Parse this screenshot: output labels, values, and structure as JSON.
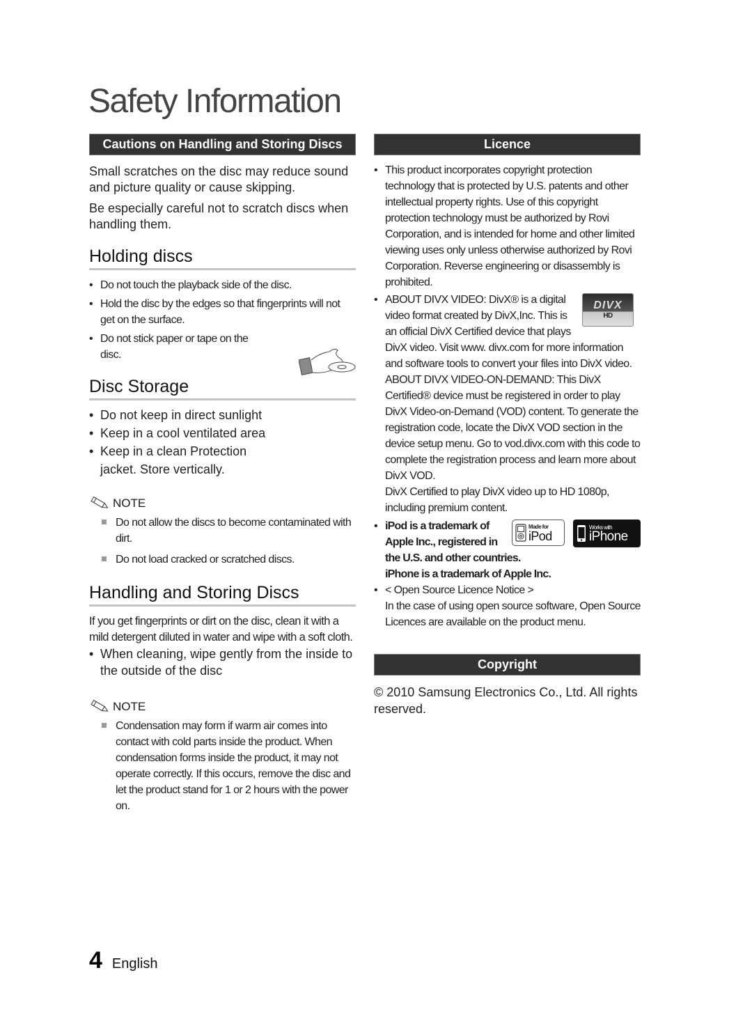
{
  "page": {
    "title": "Safety Information",
    "page_number": "4",
    "language": "English"
  },
  "left": {
    "cautions": {
      "header": "Cautions on Handling and Storing Discs",
      "paragraphs": [
        "Small scratches on the disc may reduce sound and picture quality or cause skipping.",
        "Be especially careful not to scratch discs when handling them."
      ]
    },
    "holding": {
      "heading": "Holding discs",
      "items": [
        "Do not touch the playback side of the disc.",
        "Hold the disc by the edges so that fingerprints will not get on the surface.",
        "Do not stick paper or tape on the disc."
      ],
      "illustration": "hand-holding-disc-icon"
    },
    "storage": {
      "heading": "Disc Storage",
      "items": [
        "Do not keep in direct sunlight",
        "Keep in a cool ventilated area",
        "Keep in a clean Protection jacket. Store vertically."
      ],
      "note_label": "NOTE",
      "notes": [
        "Do not allow the discs to become contaminated with dirt.",
        "Do not load cracked or scratched discs."
      ]
    },
    "handling": {
      "heading": "Handling and Storing Discs",
      "paragraph": "If you get fingerprints or dirt on the disc, clean it with a mild detergent diluted in water and wipe with a soft cloth.",
      "items": [
        "When cleaning, wipe gently from the inside to the outside of the disc"
      ],
      "note_label": "NOTE",
      "notes": [
        "Condensation may form if warm air comes into contact with cold parts inside the product. When condensation forms inside the product, it may not operate correctly. If this occurs, remove the disc and let the product stand for 1 or 2 hours with the power on."
      ]
    }
  },
  "right": {
    "licence": {
      "header": "Licence",
      "rovi": "This product incorporates copyright protection technology that is protected by U.S. patents and other intellectual property rights. Use of this copyright protection technology must be authorized by Rovi Corporation, and is intended for home and other limited viewing uses only unless otherwise authorized by Rovi Corporation. Reverse engineering or disassembly is prohibited.",
      "divx_para1": "ABOUT DIVX VIDEO: DivX® is a digital video format created by DivX,Inc. This is an official DivX Certified device that plays DivX video. Visit www. divx.com for more information and software tools to convert your files into DivX video. ABOUT DIVX VIDEO-ON-DEMAND: This DivX Certified® device must be registered in order to play DivX Video-on-Demand (VOD) content. To generate the registration code, locate the DivX VOD section in the device setup menu. Go to vod.divx.com with this code to complete the registration process and learn more about DivX VOD.",
      "divx_para2": "DivX Certified to play DivX video up to HD 1080p, including premium content.",
      "divx_logo": {
        "top": "DIVX",
        "bottom": "HD"
      },
      "ipod_text": "iPod is a trademark of Apple Inc., registered in the U.S. and other countries.",
      "iphone_text": "iPhone is a trademark of Apple Inc.",
      "badge_ipod": {
        "small": "Made for",
        "big": "iPod"
      },
      "badge_iphone": {
        "small": "Works with",
        "big": "iPhone"
      },
      "open_source_title": "< Open Source Licence Notice >",
      "open_source_text": "In the case of using open source software, Open Source Licences are available on the product menu."
    },
    "copyright": {
      "header": "Copyright",
      "text": "© 2010 Samsung Electronics Co., Ltd. All rights reserved."
    }
  }
}
